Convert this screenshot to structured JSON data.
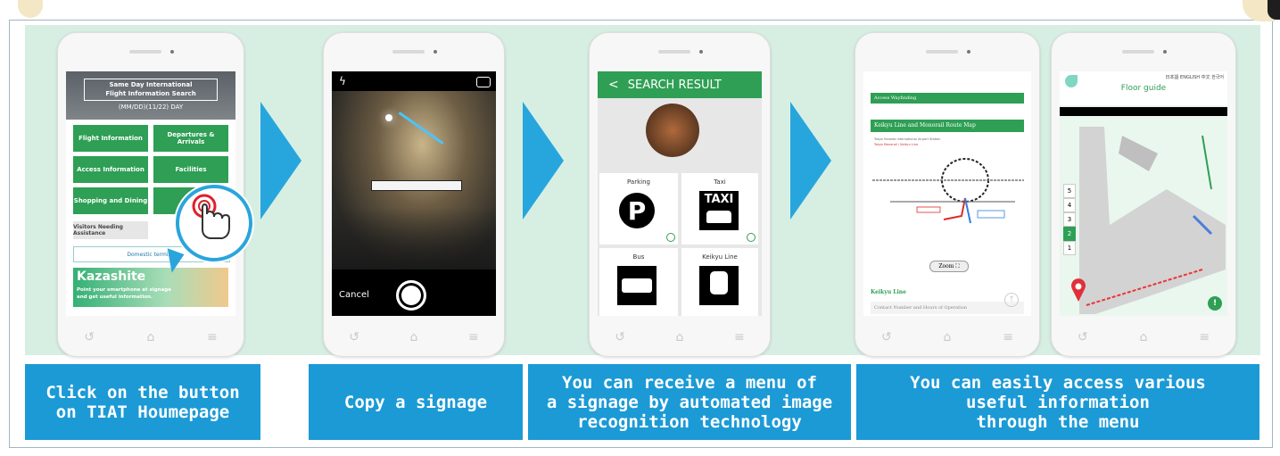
{
  "phone1": {
    "header_line1": "Same Day International",
    "header_line2": "Flight Information Search",
    "header_sub": "(MM/DD)(11/22)  DAY",
    "buttons": [
      "Flight Information",
      "Departures & Arrivals",
      "Access Information",
      "Facilities",
      "Shopping and Dining"
    ],
    "visitor_button": "Visitors Needing Assistance",
    "domestic_button": "Domestic terminal",
    "kazashite_title": "Kazashite",
    "kazashite_line1": "Point your smartphone at signage",
    "kazashite_line2": "and get useful information."
  },
  "phone2": {
    "cancel": "Cancel"
  },
  "phone3": {
    "title": "SEARCH RESULT",
    "tiles": [
      {
        "label": "Parking",
        "icon": "P"
      },
      {
        "label": "Taxi",
        "icon": "TAXI"
      },
      {
        "label": "Bus",
        "icon": ""
      },
      {
        "label": "Keikyu Line",
        "icon": ""
      }
    ]
  },
  "phone4": {
    "bar1": "Access Wayfinding",
    "bar2": "Keikyu Line and Monorail Route Map",
    "legend1": "Tokyo Haneda International Airport Station",
    "legend2": "Tokyo Monorail / Keikyu Line",
    "zoom": "Zoom",
    "keikyu_line": "Keikyu Line",
    "contact": "Contact Number and Hours of Operation"
  },
  "phone5": {
    "langs": "日本語 ENGLISH 中文 한국어",
    "title": "Floor guide",
    "floors": [
      "5",
      "4",
      "3",
      "2",
      "1"
    ]
  },
  "captions": [
    "Click on the button\non TIAT Houmepage",
    "Copy a signage",
    "You can receive a menu of\na signage by automated image\nrecognition technology",
    "You can easily access various\nuseful information\nthrough the menu"
  ],
  "colors": {
    "panel": "#d7efe3",
    "arrow": "#27a6dd",
    "caption": "#1b9ad6",
    "green": "#2e9f54"
  }
}
